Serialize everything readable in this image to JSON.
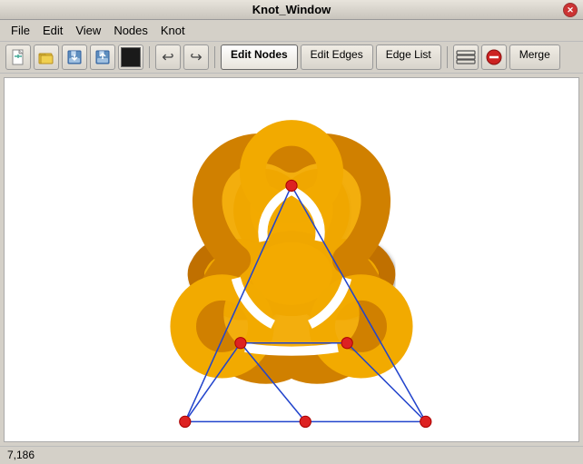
{
  "window": {
    "title": "Knot_Window"
  },
  "menu": {
    "items": [
      "File",
      "Edit",
      "View",
      "Nodes",
      "Knot"
    ]
  },
  "toolbar": {
    "buttons": [
      "new",
      "open",
      "save-down",
      "save",
      "color"
    ],
    "undo_label": "↩",
    "redo_label": "↪"
  },
  "tabs": {
    "items": [
      "Edit Nodes",
      "Edit Edges",
      "Edge List"
    ],
    "active": "Edit Nodes"
  },
  "toolbar_right": {
    "stack_label": "⚡",
    "stop_label": "🚫",
    "merge_label": "Merge"
  },
  "status": {
    "text": "7,186"
  }
}
